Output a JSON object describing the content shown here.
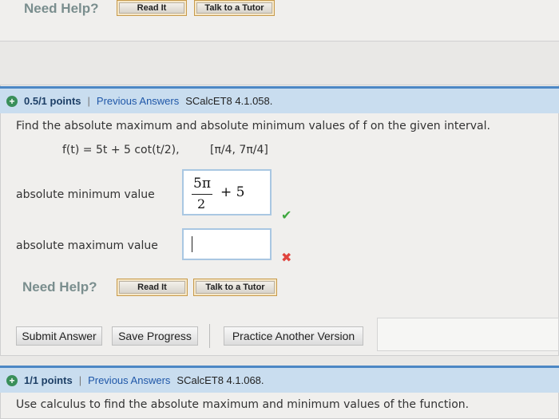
{
  "top_help": {
    "need_help": "Need Help?",
    "read_it": "Read It",
    "talk_to_tutor": "Talk to a Tutor"
  },
  "question1": {
    "points": "0.5/1 points",
    "separator": "|",
    "previous_answers": "Previous Answers",
    "code": "SCalcET8 4.1.058.",
    "prompt_text": "Find the absolute maximum and absolute minimum values of f on the given interval.",
    "function": "f(t) = 5t + 5 cot(t/2),",
    "interval": "[π/4, 7π/4]",
    "min_label": "absolute minimum value",
    "min_answer_num": "5π",
    "min_answer_den": "2",
    "min_answer_rest": "+ 5",
    "max_label": "absolute maximum value",
    "max_answer": "",
    "correct_mark": "✔",
    "incorrect_mark": "✖",
    "need_help": "Need Help?",
    "read_it": "Read It",
    "talk_to_tutor": "Talk to a Tutor",
    "submit": "Submit Answer",
    "save": "Save Progress",
    "practice": "Practice Another Version"
  },
  "question2": {
    "points": "1/1 points",
    "separator": "|",
    "previous_answers": "Previous Answers",
    "code": "SCalcET8 4.1.068.",
    "prompt_text": "Use calculus to find the absolute maximum and minimum values of the function."
  },
  "colors": {
    "header_bg": "#c9ddef",
    "header_border": "#4c87c4",
    "correct": "#3fa83f",
    "incorrect": "#e0443e"
  }
}
